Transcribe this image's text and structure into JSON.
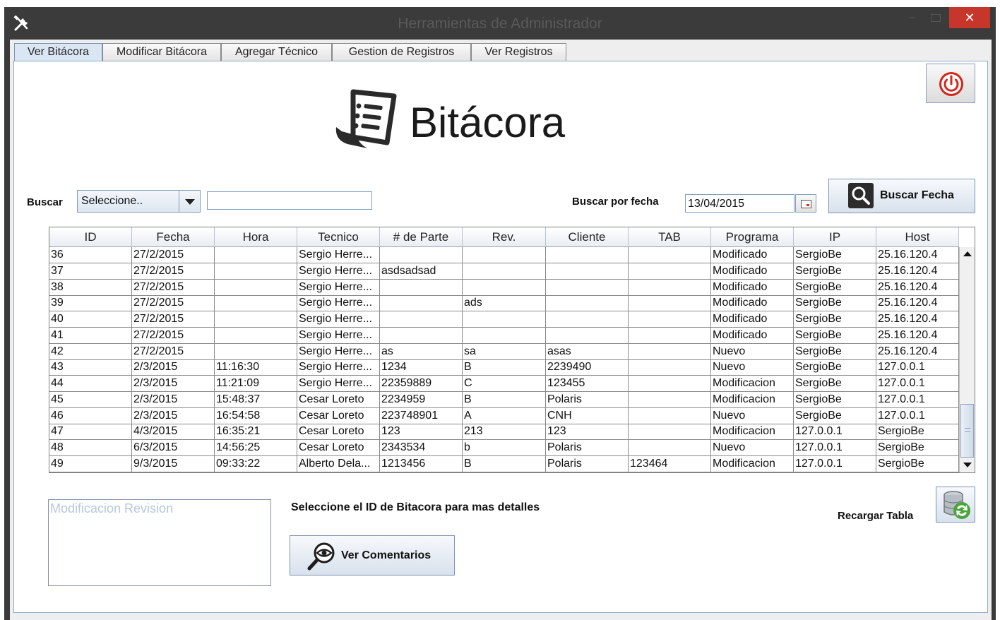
{
  "window": {
    "title": "Herramientas de Administrador",
    "minimize_glyph": "–",
    "close_glyph": "✕"
  },
  "tabs": [
    {
      "label": "Ver Bitácora",
      "active": true
    },
    {
      "label": "Modificar Bitácora"
    },
    {
      "label": "Agregar Técnico"
    },
    {
      "label": "Gestion de Registros"
    },
    {
      "label": "Ver Registros"
    }
  ],
  "icons": [
    "tools-icon",
    "power-icon",
    "document-list-icon",
    "search-icon",
    "calendar-icon",
    "eye-magnifier-icon",
    "database-refresh-icon"
  ],
  "colors": {
    "close_button": "#c7362b",
    "power_icon": "#d3261c",
    "panel_border": "#8da9cb"
  },
  "heading": "Bitácora",
  "search": {
    "label": "Buscar",
    "select_value": "Seleccione..",
    "input_value": ""
  },
  "date_search": {
    "label": "Buscar por fecha",
    "date_value": "13/04/2015",
    "button_label": "Buscar Fecha"
  },
  "table": {
    "columns": [
      "ID",
      "Fecha",
      "Hora",
      "Tecnico",
      "# de Parte",
      "Rev.",
      "Cliente",
      "TAB",
      "Programa",
      "IP",
      "Host"
    ],
    "rows": [
      [
        "36",
        "27/2/2015",
        "",
        "Sergio Herre...",
        "",
        "",
        "",
        "",
        "Modificado",
        "SergioBe",
        "25.16.120.4"
      ],
      [
        "37",
        "27/2/2015",
        "",
        "Sergio Herre...",
        "asdsadsad",
        "",
        "",
        "",
        "Modificado",
        "SergioBe",
        "25.16.120.4"
      ],
      [
        "38",
        "27/2/2015",
        "",
        "Sergio Herre...",
        "",
        "",
        "",
        "",
        "Modificado",
        "SergioBe",
        "25.16.120.4"
      ],
      [
        "39",
        "27/2/2015",
        "",
        "Sergio Herre...",
        "",
        "ads",
        "",
        "",
        "Modificado",
        "SergioBe",
        "25.16.120.4"
      ],
      [
        "40",
        "27/2/2015",
        "",
        "Sergio Herre...",
        "",
        "",
        "",
        "",
        "Modificado",
        "SergioBe",
        "25.16.120.4"
      ],
      [
        "41",
        "27/2/2015",
        "",
        "Sergio Herre...",
        "",
        "",
        "",
        "",
        "Modificado",
        "SergioBe",
        "25.16.120.4"
      ],
      [
        "42",
        "27/2/2015",
        "",
        "Sergio Herre...",
        "as",
        "sa",
        "asas",
        "",
        "Nuevo",
        "SergioBe",
        "25.16.120.4"
      ],
      [
        "43",
        "2/3/2015",
        "11:16:30",
        "Sergio Herre...",
        "1234",
        "B",
        "2239490",
        "",
        "Nuevo",
        "SergioBe",
        "127.0.0.1"
      ],
      [
        "44",
        "2/3/2015",
        "11:21:09",
        "Sergio Herre...",
        "22359889",
        "C",
        "123455",
        "",
        "Modificacion",
        "SergioBe",
        "127.0.0.1"
      ],
      [
        "45",
        "2/3/2015",
        "15:48:37",
        "Cesar Loreto",
        "2234959",
        "B",
        "Polaris",
        "",
        "Modificacion",
        "SergioBe",
        "127.0.0.1"
      ],
      [
        "46",
        "2/3/2015",
        "16:54:58",
        "Cesar Loreto",
        "223748901",
        "A",
        "CNH",
        "",
        "Nuevo",
        "SergioBe",
        "127.0.0.1"
      ],
      [
        "47",
        "4/3/2015",
        "16:35:21",
        "Cesar Loreto",
        "123",
        "213",
        "123",
        "",
        "Modificacion",
        "127.0.0.1",
        "SergioBe"
      ],
      [
        "48",
        "6/3/2015",
        "14:56:25",
        "Cesar Loreto",
        "2343534",
        "b",
        "Polaris",
        "",
        "Nuevo",
        "127.0.0.1",
        "SergioBe"
      ],
      [
        "49",
        "9/3/2015",
        "09:33:22",
        "Alberto Dela...",
        "1213456",
        "B",
        "Polaris",
        "123464",
        "Modificacion",
        "127.0.0.1",
        "SergioBe"
      ]
    ]
  },
  "details": {
    "placeholder": "Modificacion Revision",
    "select_info": "Seleccione el ID de Bitacora para mas detalles",
    "ver_comentarios_label": "Ver Comentarios",
    "reload_label": "Recargar Tabla"
  }
}
